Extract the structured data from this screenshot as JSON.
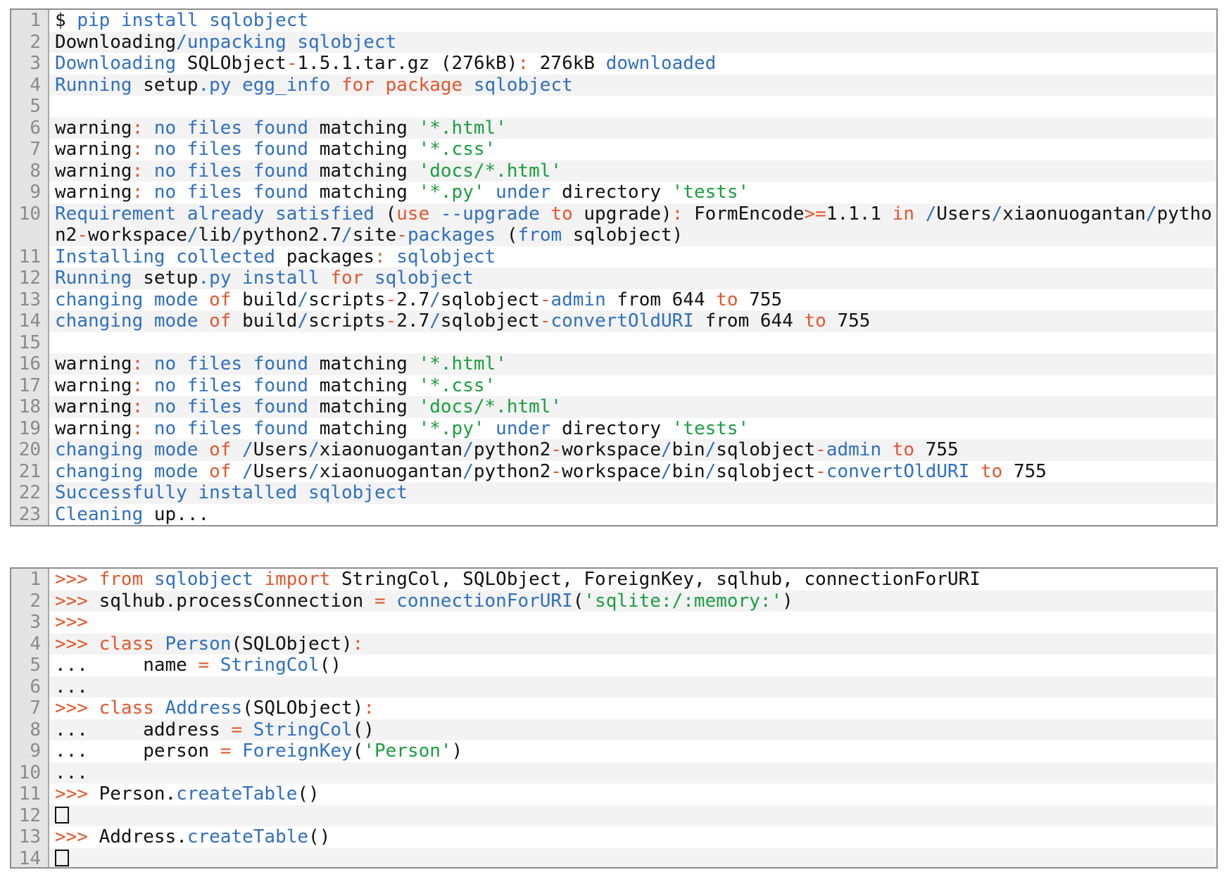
{
  "blocks": [
    {
      "id": "pip-install-output",
      "lines": [
        {
          "num": "1",
          "tokens": [
            [
              "p",
              "$ "
            ],
            [
              "k",
              "pip install sqlobject"
            ]
          ]
        },
        {
          "num": "2",
          "tokens": [
            [
              "p",
              "Downloading"
            ],
            [
              "k",
              "/unpacking sqlobject"
            ]
          ]
        },
        {
          "num": "3",
          "tokens": [
            [
              "k",
              "Downloading "
            ],
            [
              "p",
              "SQLObject"
            ],
            [
              "r",
              "-"
            ],
            [
              "p",
              "1.5.1.tar.gz (276kB)"
            ],
            [
              "r",
              ":"
            ],
            [
              "p",
              " 276kB "
            ],
            [
              "k",
              "downloaded"
            ]
          ]
        },
        {
          "num": "4",
          "tokens": [
            [
              "k",
              "Running "
            ],
            [
              "p",
              "setup"
            ],
            [
              "k",
              ".py egg_info "
            ],
            [
              "r",
              "for "
            ],
            [
              "r",
              "package "
            ],
            [
              "k",
              "sqlobject"
            ]
          ]
        },
        {
          "num": "5",
          "tokens": [
            [
              "p",
              ""
            ]
          ]
        },
        {
          "num": "6",
          "tokens": [
            [
              "p",
              "warning"
            ],
            [
              "r",
              ": "
            ],
            [
              "k",
              "no files found "
            ],
            [
              "p",
              "matching "
            ],
            [
              "s",
              "'*.html'"
            ]
          ]
        },
        {
          "num": "7",
          "tokens": [
            [
              "p",
              "warning"
            ],
            [
              "r",
              ": "
            ],
            [
              "k",
              "no files found "
            ],
            [
              "p",
              "matching "
            ],
            [
              "s",
              "'*.css'"
            ]
          ]
        },
        {
          "num": "8",
          "tokens": [
            [
              "p",
              "warning"
            ],
            [
              "r",
              ": "
            ],
            [
              "k",
              "no files found "
            ],
            [
              "p",
              "matching "
            ],
            [
              "s",
              "'docs/*.html'"
            ]
          ]
        },
        {
          "num": "9",
          "tokens": [
            [
              "p",
              "warning"
            ],
            [
              "r",
              ": "
            ],
            [
              "k",
              "no files found "
            ],
            [
              "p",
              "matching "
            ],
            [
              "s",
              "'*.py' "
            ],
            [
              "k",
              "under "
            ],
            [
              "p",
              "directory "
            ],
            [
              "s",
              "'tests'"
            ]
          ]
        },
        {
          "num": "10",
          "tokens": [
            [
              "k",
              "Requirement already satisfied "
            ],
            [
              "p",
              "("
            ],
            [
              "r",
              "use "
            ],
            [
              "k",
              "--upgrade "
            ],
            [
              "r",
              "to "
            ],
            [
              "p",
              "upgrade)"
            ],
            [
              "r",
              ": "
            ],
            [
              "p",
              "FormEncode"
            ],
            [
              "r",
              ">="
            ],
            [
              "p",
              "1.1.1 "
            ],
            [
              "r",
              "in "
            ],
            [
              "k",
              "/"
            ],
            [
              "p",
              "Users"
            ],
            [
              "k",
              "/"
            ],
            [
              "p",
              "xiaonuogantan"
            ],
            [
              "k",
              "/"
            ],
            [
              "p",
              "python2"
            ],
            [
              "r",
              "-"
            ],
            [
              "p",
              "workspace"
            ],
            [
              "k",
              "/"
            ],
            [
              "p",
              "lib"
            ],
            [
              "k",
              "/"
            ],
            [
              "p",
              "python2.7"
            ],
            [
              "k",
              "/"
            ],
            [
              "p",
              "site"
            ],
            [
              "r",
              "-"
            ],
            [
              "k",
              "packages "
            ],
            [
              "p",
              "("
            ],
            [
              "k",
              "from "
            ],
            [
              "p",
              "sqlobject)"
            ]
          ]
        },
        {
          "num": "11",
          "tokens": [
            [
              "k",
              "Installing collected "
            ],
            [
              "p",
              "packages"
            ],
            [
              "r",
              ": "
            ],
            [
              "k",
              "sqlobject"
            ]
          ]
        },
        {
          "num": "12",
          "tokens": [
            [
              "k",
              "Running "
            ],
            [
              "p",
              "setup"
            ],
            [
              "k",
              ".py install "
            ],
            [
              "r",
              "for "
            ],
            [
              "k",
              "sqlobject"
            ]
          ]
        },
        {
          "num": "13",
          "tokens": [
            [
              "k",
              "changing mode "
            ],
            [
              "r",
              "of "
            ],
            [
              "p",
              "build"
            ],
            [
              "k",
              "/"
            ],
            [
              "p",
              "scripts"
            ],
            [
              "r",
              "-"
            ],
            [
              "p",
              "2.7"
            ],
            [
              "k",
              "/"
            ],
            [
              "p",
              "sqlobject"
            ],
            [
              "r",
              "-"
            ],
            [
              "k",
              "admin "
            ],
            [
              "p",
              "from 644 "
            ],
            [
              "r",
              "to "
            ],
            [
              "p",
              "755"
            ]
          ]
        },
        {
          "num": "14",
          "tokens": [
            [
              "k",
              "changing mode "
            ],
            [
              "r",
              "of "
            ],
            [
              "p",
              "build"
            ],
            [
              "k",
              "/"
            ],
            [
              "p",
              "scripts"
            ],
            [
              "r",
              "-"
            ],
            [
              "p",
              "2.7"
            ],
            [
              "k",
              "/"
            ],
            [
              "p",
              "sqlobject"
            ],
            [
              "r",
              "-"
            ],
            [
              "k",
              "convertOldURI "
            ],
            [
              "p",
              "from 644 "
            ],
            [
              "r",
              "to "
            ],
            [
              "p",
              "755"
            ]
          ]
        },
        {
          "num": "15",
          "tokens": [
            [
              "p",
              ""
            ]
          ]
        },
        {
          "num": "16",
          "tokens": [
            [
              "p",
              "warning"
            ],
            [
              "r",
              ": "
            ],
            [
              "k",
              "no files found "
            ],
            [
              "p",
              "matching "
            ],
            [
              "s",
              "'*.html'"
            ]
          ]
        },
        {
          "num": "17",
          "tokens": [
            [
              "p",
              "warning"
            ],
            [
              "r",
              ": "
            ],
            [
              "k",
              "no files found "
            ],
            [
              "p",
              "matching "
            ],
            [
              "s",
              "'*.css'"
            ]
          ]
        },
        {
          "num": "18",
          "tokens": [
            [
              "p",
              "warning"
            ],
            [
              "r",
              ": "
            ],
            [
              "k",
              "no files found "
            ],
            [
              "p",
              "matching "
            ],
            [
              "s",
              "'docs/*.html'"
            ]
          ]
        },
        {
          "num": "19",
          "tokens": [
            [
              "p",
              "warning"
            ],
            [
              "r",
              ": "
            ],
            [
              "k",
              "no files found "
            ],
            [
              "p",
              "matching "
            ],
            [
              "s",
              "'*.py' "
            ],
            [
              "k",
              "under "
            ],
            [
              "p",
              "directory "
            ],
            [
              "s",
              "'tests'"
            ]
          ]
        },
        {
          "num": "20",
          "tokens": [
            [
              "k",
              "changing mode "
            ],
            [
              "r",
              "of "
            ],
            [
              "k",
              "/"
            ],
            [
              "p",
              "Users"
            ],
            [
              "k",
              "/"
            ],
            [
              "p",
              "xiaonuogantan"
            ],
            [
              "k",
              "/"
            ],
            [
              "p",
              "python2"
            ],
            [
              "r",
              "-"
            ],
            [
              "p",
              "workspace"
            ],
            [
              "k",
              "/"
            ],
            [
              "p",
              "bin"
            ],
            [
              "k",
              "/"
            ],
            [
              "p",
              "sqlobject"
            ],
            [
              "r",
              "-"
            ],
            [
              "k",
              "admin "
            ],
            [
              "r",
              "to "
            ],
            [
              "p",
              "755"
            ]
          ]
        },
        {
          "num": "21",
          "tokens": [
            [
              "k",
              "changing mode "
            ],
            [
              "r",
              "of "
            ],
            [
              "k",
              "/"
            ],
            [
              "p",
              "Users"
            ],
            [
              "k",
              "/"
            ],
            [
              "p",
              "xiaonuogantan"
            ],
            [
              "k",
              "/"
            ],
            [
              "p",
              "python2"
            ],
            [
              "r",
              "-"
            ],
            [
              "p",
              "workspace"
            ],
            [
              "k",
              "/"
            ],
            [
              "p",
              "bin"
            ],
            [
              "k",
              "/"
            ],
            [
              "p",
              "sqlobject"
            ],
            [
              "r",
              "-"
            ],
            [
              "k",
              "convertOldURI "
            ],
            [
              "r",
              "to "
            ],
            [
              "p",
              "755"
            ]
          ]
        },
        {
          "num": "22",
          "tokens": [
            [
              "k",
              "Successfully installed sqlobject"
            ]
          ]
        },
        {
          "num": "23",
          "tokens": [
            [
              "k",
              "Cleaning "
            ],
            [
              "p",
              "up..."
            ]
          ]
        }
      ]
    },
    {
      "id": "python-repl-session",
      "lines": [
        {
          "num": "1",
          "tokens": [
            [
              "o",
              ">>> "
            ],
            [
              "r",
              "from "
            ],
            [
              "k",
              "sqlobject "
            ],
            [
              "r",
              "import "
            ],
            [
              "p",
              "StringCol, SQLObject, ForeignKey, sqlhub, connectionForURI"
            ]
          ]
        },
        {
          "num": "2",
          "tokens": [
            [
              "o",
              ">>> "
            ],
            [
              "p",
              "sqlhub.processConnection "
            ],
            [
              "r",
              "= "
            ],
            [
              "k",
              "connectionForURI"
            ],
            [
              "p",
              "("
            ],
            [
              "s",
              "'sqlite:/:memory:'"
            ],
            [
              "p",
              ")"
            ]
          ]
        },
        {
          "num": "3",
          "tokens": [
            [
              "o",
              ">>>"
            ]
          ]
        },
        {
          "num": "4",
          "tokens": [
            [
              "o",
              ">>> "
            ],
            [
              "r",
              "class "
            ],
            [
              "k",
              "Person"
            ],
            [
              "p",
              "(SQLObject)"
            ],
            [
              "r",
              ":"
            ]
          ]
        },
        {
          "num": "5",
          "tokens": [
            [
              "p",
              "...     name "
            ],
            [
              "r",
              "= "
            ],
            [
              "k",
              "StringCol"
            ],
            [
              "p",
              "()"
            ]
          ]
        },
        {
          "num": "6",
          "tokens": [
            [
              "p",
              "..."
            ]
          ]
        },
        {
          "num": "7",
          "tokens": [
            [
              "o",
              ">>> "
            ],
            [
              "r",
              "class "
            ],
            [
              "k",
              "Address"
            ],
            [
              "p",
              "(SQLObject)"
            ],
            [
              "r",
              ":"
            ]
          ]
        },
        {
          "num": "8",
          "tokens": [
            [
              "p",
              "...     address "
            ],
            [
              "r",
              "= "
            ],
            [
              "k",
              "StringCol"
            ],
            [
              "p",
              "()"
            ]
          ]
        },
        {
          "num": "9",
          "tokens": [
            [
              "p",
              "...     person "
            ],
            [
              "r",
              "= "
            ],
            [
              "k",
              "ForeignKey"
            ],
            [
              "p",
              "("
            ],
            [
              "s",
              "'Person'"
            ],
            [
              "p",
              ")"
            ]
          ]
        },
        {
          "num": "10",
          "tokens": [
            [
              "p",
              "..."
            ]
          ]
        },
        {
          "num": "11",
          "tokens": [
            [
              "o",
              ">>> "
            ],
            [
              "p",
              "Person."
            ],
            [
              "k",
              "createTable"
            ],
            [
              "p",
              "()"
            ]
          ]
        },
        {
          "num": "12",
          "tokens": [
            [
              "box",
              ""
            ]
          ]
        },
        {
          "num": "13",
          "tokens": [
            [
              "o",
              ">>> "
            ],
            [
              "p",
              "Address."
            ],
            [
              "k",
              "createTable"
            ],
            [
              "p",
              "()"
            ]
          ]
        },
        {
          "num": "14",
          "tokens": [
            [
              "box",
              ""
            ]
          ]
        }
      ]
    }
  ],
  "colors": {
    "keyword_blue": "#2f6fc0",
    "operator_red": "#e4572e",
    "string_green": "#1a9e3f",
    "plain": "#111111",
    "gutter_bg": "#e4e4e4",
    "gutter_text": "#8a8a8a",
    "stripe_bg": "#f3f3f3",
    "border": "#8e8e8e"
  },
  "icons": {
    "output_placeholder": "empty-box-icon"
  }
}
